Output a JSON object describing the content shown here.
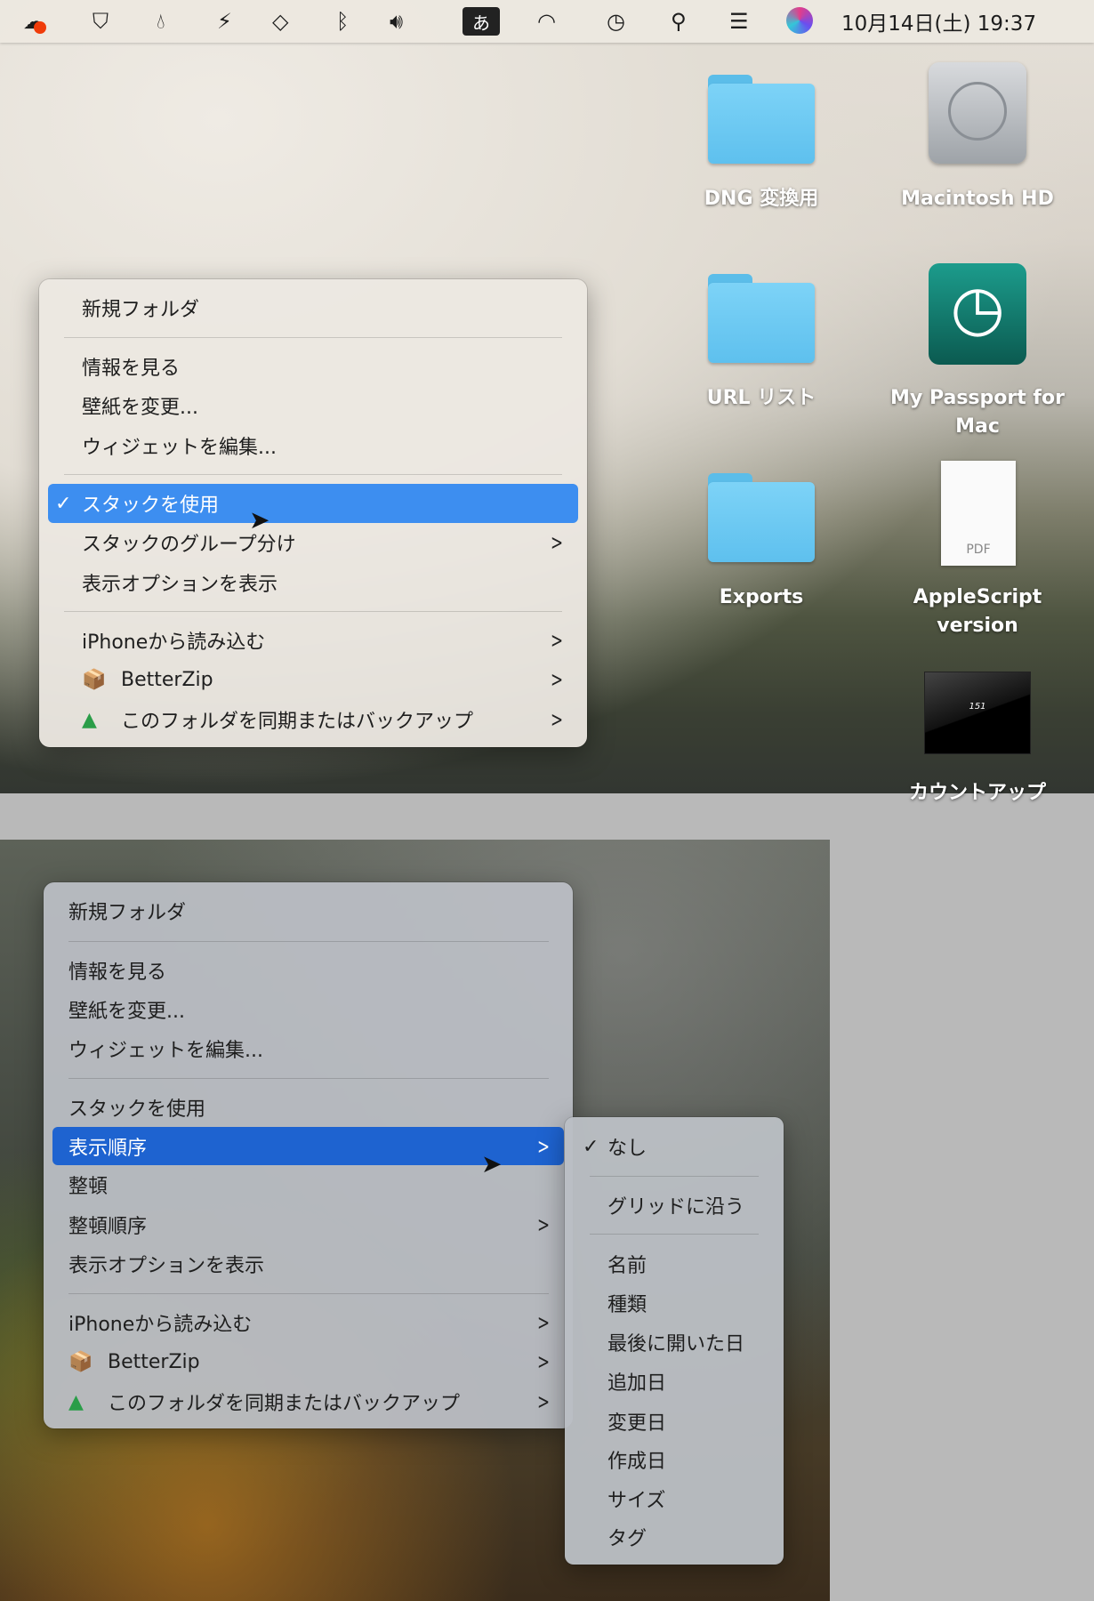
{
  "menubar": {
    "ime": "あ",
    "clock": "10月14日(土)  19:37"
  },
  "desktop": {
    "icons": [
      {
        "label": "DNG 変換用"
      },
      {
        "label": "Macintosh HD"
      },
      {
        "label": "URL リスト"
      },
      {
        "label": "My Passport for Mac"
      },
      {
        "label": "Exports"
      },
      {
        "label": "AppleScript version",
        "badge": "PDF"
      },
      {
        "label": "カウントアップ",
        "screen_text": "151"
      }
    ]
  },
  "menu1": {
    "items": [
      "新規フォルダ",
      "情報を見る",
      "壁紙を変更...",
      "ウィジェットを編集...",
      "スタックを使用",
      "スタックのグループ分け",
      "表示オプションを表示",
      "iPhoneから読み込む",
      "BetterZip",
      "このフォルダを同期またはバックアップ"
    ],
    "checked": "✓"
  },
  "menu2": {
    "items": [
      "新規フォルダ",
      "情報を見る",
      "壁紙を変更...",
      "ウィジェットを編集...",
      "スタックを使用",
      "表示順序",
      "整頓",
      "整頓順序",
      "表示オプションを表示",
      "iPhoneから読み込む",
      "BetterZip",
      "このフォルダを同期またはバックアップ"
    ]
  },
  "submenu": {
    "items": [
      "なし",
      "グリッドに沿う",
      "名前",
      "種類",
      "最後に開いた日",
      "追加日",
      "変更日",
      "作成日",
      "サイズ",
      "タグ"
    ],
    "checked": "✓"
  },
  "colors": {
    "highlight1": "#3d8ef0",
    "highlight2": "#1e63d0"
  }
}
